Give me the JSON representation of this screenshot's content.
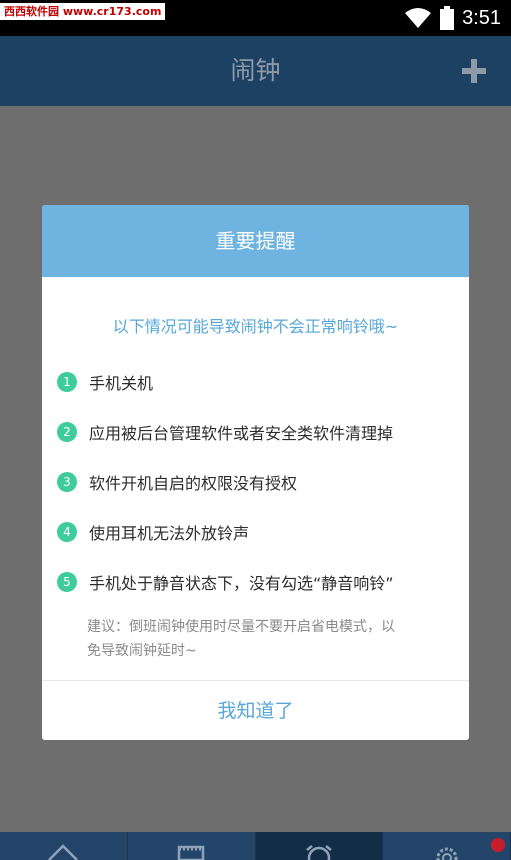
{
  "status_bar": {
    "watermark": "西西软件园 www.cr173.com",
    "time": "3:51"
  },
  "app_bar": {
    "title": "闹钟",
    "add_icon": "plus-icon"
  },
  "dialog": {
    "title": "重要提醒",
    "subtitle": "以下情况可能导致闹钟不会正常响铃哦~",
    "items": [
      {
        "num": "1",
        "text": "手机关机"
      },
      {
        "num": "2",
        "text": "应用被后台管理软件或者安全类软件清理掉"
      },
      {
        "num": "3",
        "text": "软件开机自启的权限没有授权"
      },
      {
        "num": "4",
        "text": "使用耳机无法外放铃声"
      },
      {
        "num": "5",
        "text": "手机处于静音状态下，没有勾选“静音响铃”"
      }
    ],
    "note_line1": "建议：倒班闹钟使用时尽量不要开启省电模式，以",
    "note_line2": "免导致闹钟延时~",
    "confirm_label": "我知道了"
  },
  "bottom_nav": {
    "items": [
      {
        "icon": "home-icon"
      },
      {
        "icon": "calendar-icon"
      },
      {
        "icon": "alarm-clock-icon",
        "active": true
      },
      {
        "icon": "gear-icon"
      }
    ]
  },
  "colors": {
    "app_bar": "#1d4163",
    "dialog_header": "#6fb4e0",
    "accent_text": "#58a7d8",
    "number_badge": "#3fcc9c"
  }
}
